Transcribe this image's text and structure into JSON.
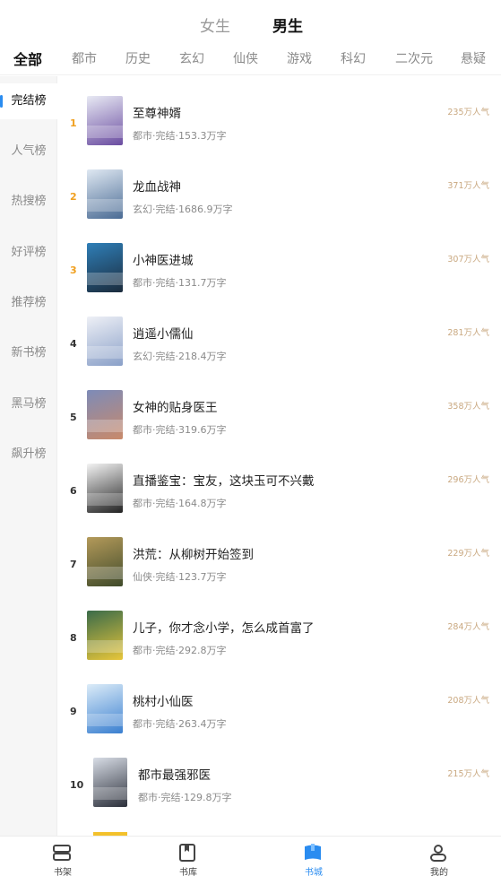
{
  "gender_tabs": {
    "female": "女生",
    "male": "男生",
    "selected": "male"
  },
  "categories": [
    "全部",
    "都市",
    "历史",
    "玄幻",
    "仙侠",
    "游戏",
    "科幻",
    "二次元",
    "悬疑"
  ],
  "selected_category": "全部",
  "sidebar": {
    "items": [
      "完结榜",
      "人气榜",
      "热搜榜",
      "好评榜",
      "推荐榜",
      "新书榜",
      "黑马榜",
      "飙升榜"
    ],
    "selected": "完结榜",
    "indicator_color": "#2a8cf0"
  },
  "books": [
    {
      "rank": "1",
      "title": "至尊神婿",
      "meta": "都市·完结·153.3万字",
      "heat": "235万人气",
      "cover_colors": [
        "#e8eaf4",
        "#6a4ca0"
      ]
    },
    {
      "rank": "2",
      "title": "龙血战神",
      "meta": "玄幻·完结·1686.9万字",
      "heat": "371万人气",
      "cover_colors": [
        "#dfe8f2",
        "#4a6b94"
      ]
    },
    {
      "rank": "3",
      "title": "小神医进城",
      "meta": "都市·完结·131.7万字",
      "heat": "307万人气",
      "cover_colors": [
        "#2f7fb8",
        "#1b2b3c"
      ]
    },
    {
      "rank": "4",
      "title": "逍遥小儒仙",
      "meta": "玄幻·完结·218.4万字",
      "heat": "281万人气",
      "cover_colors": [
        "#eef0f6",
        "#8aa0c8"
      ]
    },
    {
      "rank": "5",
      "title": "女神的贴身医王",
      "meta": "都市·完结·319.6万字",
      "heat": "358万人气",
      "cover_colors": [
        "#7d8bb8",
        "#c98a6a"
      ]
    },
    {
      "rank": "6",
      "title": "直播鉴宝：宝友，这块玉可不兴戴",
      "meta": "都市·完结·164.8万字",
      "heat": "296万人气",
      "cover_colors": [
        "#f4f4f4",
        "#222222"
      ]
    },
    {
      "rank": "7",
      "title": "洪荒：从柳树开始签到",
      "meta": "仙侠·完结·123.7万字",
      "heat": "229万人气",
      "cover_colors": [
        "#b49a5a",
        "#3f4a2a"
      ]
    },
    {
      "rank": "8",
      "title": "儿子，你才念小学，怎么成首富了",
      "meta": "都市·完结·292.8万字",
      "heat": "284万人气",
      "cover_colors": [
        "#3a6b4a",
        "#e8c63a"
      ]
    },
    {
      "rank": "9",
      "title": "桃村小仙医",
      "meta": "都市·完结·263.4万字",
      "heat": "208万人气",
      "cover_colors": [
        "#dcecf8",
        "#3a7fd0"
      ]
    },
    {
      "rank": "10",
      "title": "都市最强邪医",
      "meta": "都市·完结·129.8万字",
      "heat": "215万人气",
      "cover_colors": [
        "#d8dde6",
        "#2b2f3a"
      ]
    }
  ],
  "bottom_nav": {
    "items": [
      "书架",
      "书库",
      "书城",
      "我的"
    ],
    "icons": [
      "bookshelf-icon",
      "book-icon",
      "bookstore-icon",
      "profile-icon"
    ],
    "selected": "书城",
    "accent_color": "#2a8cf0"
  }
}
